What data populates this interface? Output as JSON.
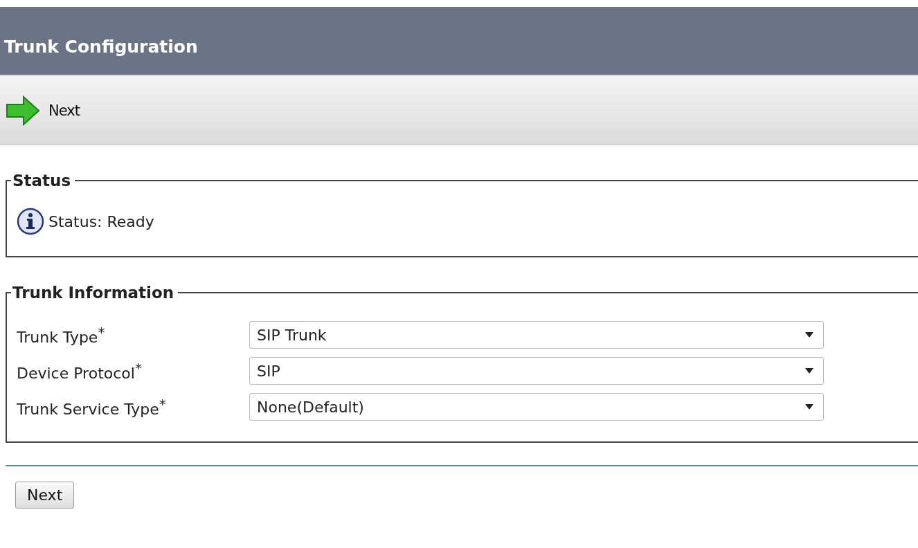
{
  "header": {
    "title": "Trunk Configuration"
  },
  "toolbar": {
    "buttons": [
      {
        "label": "Next"
      }
    ]
  },
  "status": {
    "legend": "Status",
    "message": "Status: Ready"
  },
  "trunk_information": {
    "legend": "Trunk Information",
    "fields": [
      {
        "label": "Trunk Type",
        "required_mark": "*",
        "value": "SIP Trunk"
      },
      {
        "label": "Device Protocol",
        "required_mark": "*",
        "value": "SIP"
      },
      {
        "label": "Trunk Service Type",
        "required_mark": "*",
        "value": "None(Default)"
      }
    ]
  },
  "footer": {
    "buttons": [
      {
        "label": "Next"
      }
    ]
  }
}
